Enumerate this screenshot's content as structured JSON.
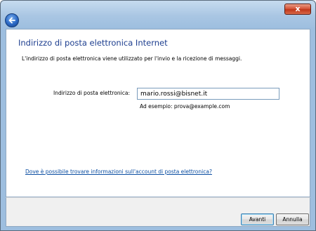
{
  "window": {
    "close_label": "x"
  },
  "nav": {
    "back_icon": "back-arrow-icon"
  },
  "main": {
    "heading": "Indirizzo di posta elettronica Internet",
    "description": "L'indirizzo di posta elettronica viene utilizzato per l'invio e la ricezione di messaggi.",
    "email_label": "Indirizzo di posta elettronica:",
    "email_value": "mario.rossi@bisnet.it",
    "example": "Ad esempio: prova@example.com",
    "help_link": "Dove è possibile trovare informazioni sull'account di posta elettronica?"
  },
  "footer": {
    "next_label": "Avanti",
    "cancel_label": "Annulla"
  },
  "colors": {
    "heading": "#1d3e8f",
    "link": "#0b4ea2",
    "close_button": "#c0371a"
  }
}
